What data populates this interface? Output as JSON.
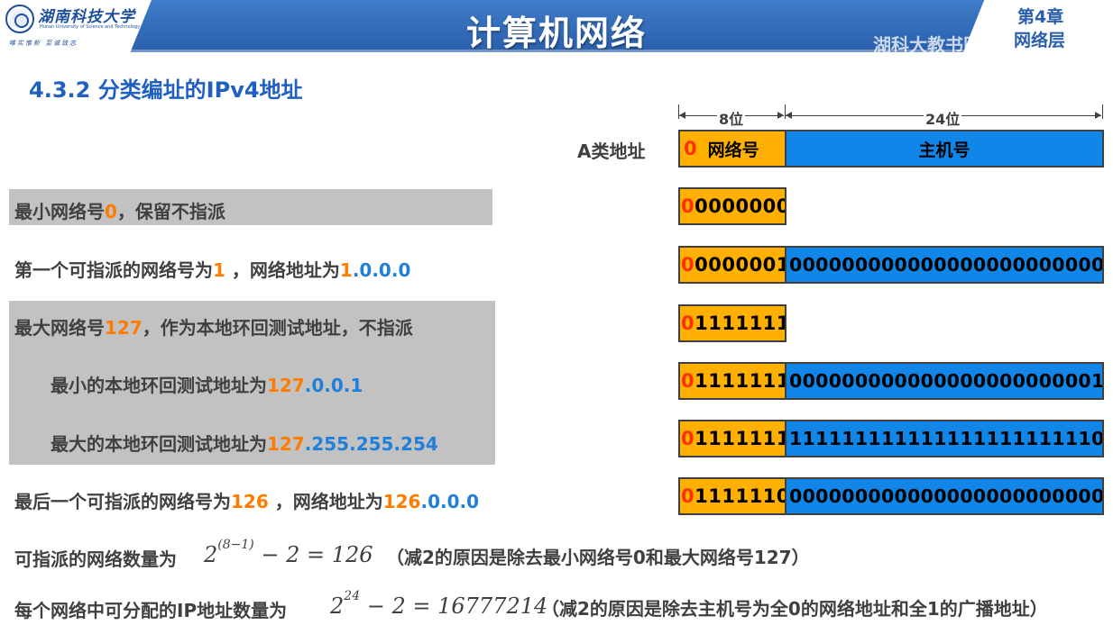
{
  "header": {
    "university_name": "湖南科技大学",
    "university_en": "Hunan University of Science and Technology",
    "motto": "唯实惟新 至诚致志",
    "title": "计算机网络",
    "chapter_number": "第4章",
    "chapter_name": "网络层",
    "watermark": "湖科大教书匠"
  },
  "section_title": "4.3.2 分类编址的IPv4地址",
  "diagram": {
    "class_label": "A类地址",
    "net_width_label": "8位",
    "host_width_label": "24位",
    "header_bit": "0",
    "net_field_label": "网络号",
    "host_field_label": "主机号",
    "rows": [
      {
        "first_bit": "0",
        "net_rest": "0000000",
        "host": ""
      },
      {
        "first_bit": "0",
        "net_rest": "0000001",
        "host": "000000000000000000000000"
      },
      {
        "first_bit": "0",
        "net_rest": "1111111",
        "host": ""
      },
      {
        "first_bit": "0",
        "net_rest": "1111111",
        "host": "000000000000000000000001"
      },
      {
        "first_bit": "0",
        "net_rest": "1111111",
        "host": "111111111111111111111110"
      },
      {
        "first_bit": "0",
        "net_rest": "1111110",
        "host": "000000000000000000000000"
      }
    ]
  },
  "lines": {
    "l1": {
      "a": "最小网络号",
      "b": "0",
      "c": "，保留不指派"
    },
    "l2": {
      "a": "第一个可指派的网络号为",
      "b": "1",
      "c": " ，网络地址为",
      "d": "1",
      "e": ".0.0.0"
    },
    "l3": {
      "a": "最大网络号",
      "b": "127",
      "c": "，作为本地环回测试地址，不指派"
    },
    "l4": {
      "a": "最小的本地环回测试地址为",
      "b": "127",
      "c": ".0.0.1"
    },
    "l5": {
      "a": "最大的本地环回测试地址为",
      "b": "127",
      "c": ".255.255.254"
    },
    "l6": {
      "a": "最后一个可指派的网络号为",
      "b": "126",
      "c": " ，网络地址为",
      "d": "126",
      "e": ".0.0.0"
    }
  },
  "formulas": {
    "f1_label": "可指派的网络数量为",
    "f1_base": "2",
    "f1_exp": "(8−1)",
    "f1_rest": "− 2 = 126",
    "f1_note": "（减2的原因是除去最小网络号0和最大网络号127）",
    "f2_label": "每个网络中可分配的IP地址数量为",
    "f2_base": "2",
    "f2_exp": "24",
    "f2_rest": "− 2 = 16777214",
    "f2_note": "（减2的原因是除去主机号为全0的网络地址和全1的广播地址）"
  },
  "colors": {
    "header_blue": "#2a5fab",
    "title_blue": "#1f5fbf",
    "orange": "#ff7c00",
    "net_field": "#ffb000",
    "host_field": "#0f86e8",
    "first_bit_red": "#ff3000"
  }
}
